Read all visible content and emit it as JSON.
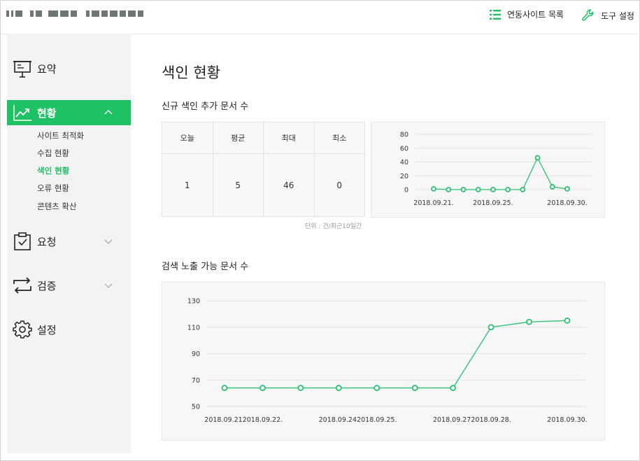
{
  "header": {
    "linked_sites_label": "연동사이트 목록",
    "tools_label": "도구 설정"
  },
  "sidebar": {
    "summary": "요약",
    "status": "현황",
    "status_items": [
      "사이트 최적화",
      "수집 현황",
      "색인 현황",
      "오류 현황",
      "콘텐츠 확산"
    ],
    "status_selected": "색인 현황",
    "request": "요청",
    "verify": "검증",
    "settings": "설정"
  },
  "main": {
    "title": "색인 현황",
    "section1_title": "신규 색인 추가 문서 수",
    "stats_headers": [
      "오늘",
      "평균",
      "최대",
      "최소"
    ],
    "stats_values": [
      "1",
      "5",
      "46",
      "0"
    ],
    "unit_note": "단위 : 건/최근10일간",
    "section2_title": "검색 노출 가능 문서 수"
  },
  "colors": {
    "accent": "#1ec163",
    "line": "#2bc06d"
  },
  "chart_data": [
    {
      "type": "line",
      "x_ticks": [
        "2018.09.21.",
        "2018.09.25.",
        "2018.09.30."
      ],
      "x": [
        "2018.09.21.",
        "2018.09.22.",
        "2018.09.23.",
        "2018.09.24.",
        "2018.09.25.",
        "2018.09.26.",
        "2018.09.27.",
        "2018.09.28.",
        "2018.09.29.",
        "2018.09.30."
      ],
      "values": [
        1,
        0,
        0,
        0,
        0,
        0,
        0,
        46,
        4,
        1
      ],
      "yticks": [
        0,
        20,
        40,
        60,
        80
      ],
      "ylim": [
        0,
        80
      ],
      "grid": true
    },
    {
      "type": "line",
      "x": [
        "2018.09.21.",
        "2018.09.22.",
        "2018.09.23.",
        "2018.09.24.",
        "2018.09.25.",
        "2018.09.26.",
        "2018.09.27.",
        "2018.09.28.",
        "2018.09.29.",
        "2018.09.30."
      ],
      "x_ticks": [
        "2018.09.21.",
        "2018.09.22.",
        "2018.09.24.",
        "2018.09.25.",
        "2018.09.27.",
        "2018.09.28.",
        "2018.09.30."
      ],
      "values": [
        64,
        64,
        64,
        64,
        64,
        64,
        64,
        110,
        114,
        115
      ],
      "yticks": [
        50,
        70,
        90,
        110,
        130
      ],
      "ylim": [
        50,
        130
      ],
      "grid": true
    }
  ]
}
